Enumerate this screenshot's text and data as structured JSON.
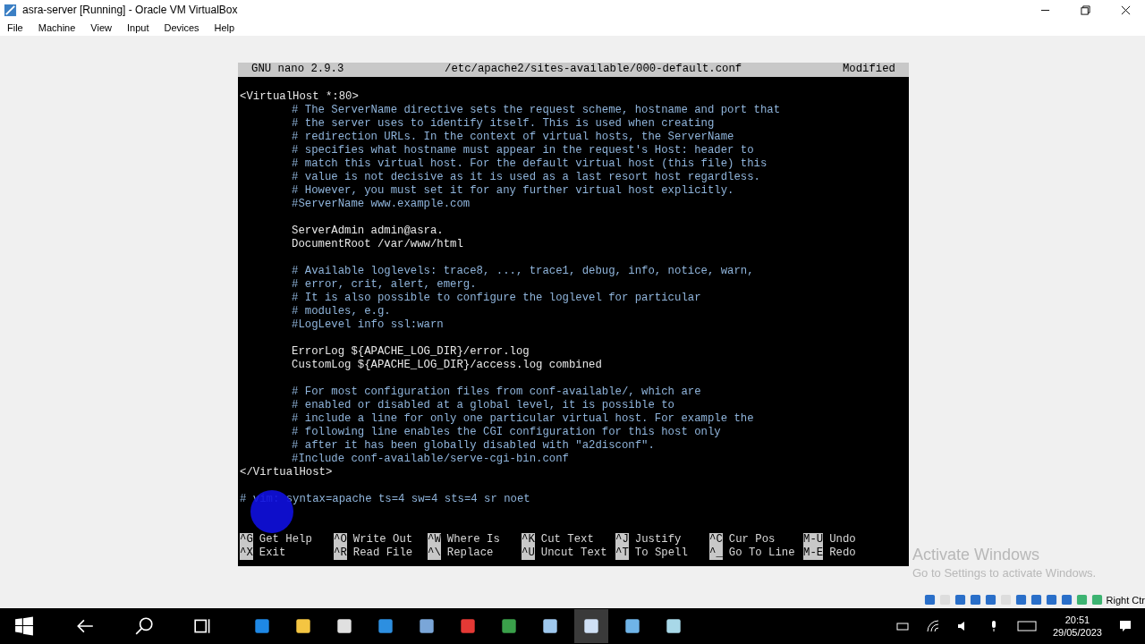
{
  "window": {
    "title": "asra-server [Running] - Oracle VM VirtualBox"
  },
  "menu": [
    "File",
    "Machine",
    "View",
    "Input",
    "Devices",
    "Help"
  ],
  "nano": {
    "version": "GNU nano 2.9.3",
    "file": "/etc/apache2/sites-available/000-default.conf",
    "status": "Modified"
  },
  "lines": [
    {
      "kind": "directive",
      "indented": false,
      "text": "<VirtualHost *:80>"
    },
    {
      "kind": "comment",
      "indented": true,
      "text": "# The ServerName directive sets the request scheme, hostname and port that"
    },
    {
      "kind": "comment",
      "indented": true,
      "text": "# the server uses to identify itself. This is used when creating"
    },
    {
      "kind": "comment",
      "indented": true,
      "text": "# redirection URLs. In the context of virtual hosts, the ServerName"
    },
    {
      "kind": "comment",
      "indented": true,
      "text": "# specifies what hostname must appear in the request's Host: header to"
    },
    {
      "kind": "comment",
      "indented": true,
      "text": "# match this virtual host. For the default virtual host (this file) this"
    },
    {
      "kind": "comment",
      "indented": true,
      "text": "# value is not decisive as it is used as a last resort host regardless."
    },
    {
      "kind": "comment",
      "indented": true,
      "text": "# However, you must set it for any further virtual host explicitly."
    },
    {
      "kind": "comment",
      "indented": true,
      "text": "#ServerName www.example.com"
    },
    {
      "kind": "blank"
    },
    {
      "kind": "directive",
      "indented": true,
      "text": "ServerAdmin admin@asra."
    },
    {
      "kind": "directive",
      "indented": true,
      "text": "DocumentRoot /var/www/html"
    },
    {
      "kind": "blank"
    },
    {
      "kind": "comment",
      "indented": true,
      "text": "# Available loglevels: trace8, ..., trace1, debug, info, notice, warn,"
    },
    {
      "kind": "comment",
      "indented": true,
      "text": "# error, crit, alert, emerg."
    },
    {
      "kind": "comment",
      "indented": true,
      "text": "# It is also possible to configure the loglevel for particular"
    },
    {
      "kind": "comment",
      "indented": true,
      "text": "# modules, e.g."
    },
    {
      "kind": "comment",
      "indented": true,
      "text": "#LogLevel info ssl:warn"
    },
    {
      "kind": "blank"
    },
    {
      "kind": "directive",
      "indented": true,
      "text": "ErrorLog ${APACHE_LOG_DIR}/error.log"
    },
    {
      "kind": "directive",
      "indented": true,
      "text": "CustomLog ${APACHE_LOG_DIR}/access.log combined"
    },
    {
      "kind": "blank"
    },
    {
      "kind": "comment",
      "indented": true,
      "text": "# For most configuration files from conf-available/, which are"
    },
    {
      "kind": "comment",
      "indented": true,
      "text": "# enabled or disabled at a global level, it is possible to"
    },
    {
      "kind": "comment",
      "indented": true,
      "text": "# include a line for only one particular virtual host. For example the"
    },
    {
      "kind": "comment",
      "indented": true,
      "text": "# following line enables the CGI configuration for this host only"
    },
    {
      "kind": "comment",
      "indented": true,
      "text": "# after it has been globally disabled with \"a2disconf\"."
    },
    {
      "kind": "comment",
      "indented": true,
      "text": "#Include conf-available/serve-cgi-bin.conf"
    },
    {
      "kind": "directive",
      "indented": false,
      "text": "</VirtualHost>"
    },
    {
      "kind": "blank"
    },
    {
      "kind": "comment",
      "indented": false,
      "text": "# vim: syntax=apache ts=4 sw=4 sts=4 sr noet"
    }
  ],
  "shortcuts": [
    [
      {
        "key": "^G",
        "label": "Get Help"
      },
      {
        "key": "^O",
        "label": "Write Out"
      },
      {
        "key": "^W",
        "label": "Where Is"
      },
      {
        "key": "^K",
        "label": "Cut Text"
      },
      {
        "key": "^J",
        "label": "Justify"
      },
      {
        "key": "^C",
        "label": "Cur Pos"
      },
      {
        "key": "M-U",
        "label": "Undo"
      }
    ],
    [
      {
        "key": "^X",
        "label": "Exit"
      },
      {
        "key": "^R",
        "label": "Read File"
      },
      {
        "key": "^\\",
        "label": "Replace"
      },
      {
        "key": "^U",
        "label": "Uncut Text"
      },
      {
        "key": "^T",
        "label": "To Spell"
      },
      {
        "key": "^_",
        "label": "Go To Line"
      },
      {
        "key": "M-E",
        "label": "Redo"
      }
    ]
  ],
  "activation": {
    "title": "Activate Windows",
    "subtitle": "Go to Settings to activate Windows."
  },
  "host_key": "Right Ctr",
  "clock": {
    "time": "20:51",
    "date": "29/05/2023"
  }
}
